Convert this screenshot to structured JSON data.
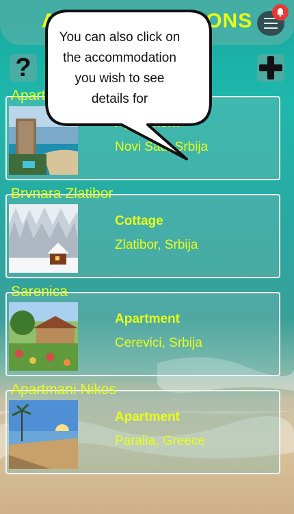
{
  "header": {
    "title": "ACCOMMODATIONS",
    "menu_icon": "hamburger-menu-icon",
    "notification_icon": "bell-icon",
    "notification_color": "#e53935"
  },
  "toolbar": {
    "help_label": "?",
    "add_icon": "plus-icon"
  },
  "tooltip": {
    "text": "You can also click on the accommodation you wish to see details for"
  },
  "accommodations": [
    {
      "name": "Apartmani",
      "type": "Apartment",
      "location": "Novi Sad, Srbija"
    },
    {
      "name": "Brvnara Zlatibor",
      "type": "Cottage",
      "location": "Zlatibor, Srbija"
    },
    {
      "name": "Sarenica",
      "type": "Apartment",
      "location": "Cerevici, Srbija"
    },
    {
      "name": "Apartmani Nikos",
      "type": "Apartment",
      "location": "Paralia, Greece"
    }
  ],
  "colors": {
    "accent": "#e6ff1a",
    "card_border": "#eef3f3",
    "menu_button": "#2f4f53"
  }
}
